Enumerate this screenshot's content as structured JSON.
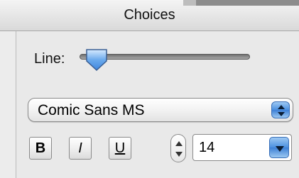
{
  "window": {
    "title": "Choices"
  },
  "line": {
    "label": "Line:",
    "value": 0.05
  },
  "font": {
    "selected": "Comic Sans MS"
  },
  "style_buttons": {
    "bold": "B",
    "italic": "I",
    "underline": "U"
  },
  "size": {
    "value": "14"
  },
  "colors": {
    "accent": "#4a8fe0",
    "panel": "#ececec"
  }
}
